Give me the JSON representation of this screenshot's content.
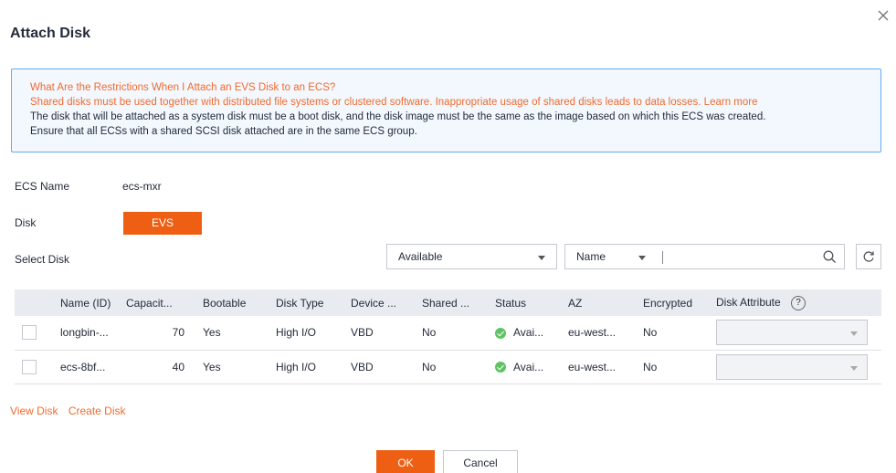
{
  "dialog": {
    "title": "Attach Disk",
    "close_icon": "close-icon"
  },
  "notice": {
    "heading": "What Are the Restrictions When I Attach an EVS Disk to an ECS?",
    "shared_warning": "Shared disks must be used together with distributed file systems or clustered software. Inappropriate usage of shared disks leads to data losses.",
    "learn_more": "Learn more",
    "line3": "The disk that will be attached as a system disk must be a boot disk, and the disk image must be the same as the image based on which this ECS was created.",
    "line4": "Ensure that all ECSs with a shared SCSI disk attached are in the same ECS group."
  },
  "form": {
    "ecs_name_label": "ECS Name",
    "ecs_name_value": "ecs-mxr",
    "disk_label": "Disk",
    "disk_type_button": "EVS",
    "select_disk_label": "Select Disk",
    "status_filter": "Available",
    "search_field": "Name",
    "search_icon": "search-icon",
    "refresh_icon": "refresh-icon"
  },
  "table": {
    "headers": [
      "Name (ID)",
      "Capacit...",
      "Bootable",
      "Disk Type",
      "Device ...",
      "Shared ...",
      "Status",
      "AZ",
      "Encrypted",
      "Disk Attribute"
    ],
    "rows": [
      {
        "name": "longbin-...",
        "capacity": "70",
        "bootable": "Yes",
        "disk_type": "High I/O",
        "device": "VBD",
        "shared": "No",
        "status": "Avai...",
        "az": "eu-west...",
        "encrypted": "No"
      },
      {
        "name": "ecs-8bf...",
        "capacity": "40",
        "bootable": "Yes",
        "disk_type": "High I/O",
        "device": "VBD",
        "shared": "No",
        "status": "Avai...",
        "az": "eu-west...",
        "encrypted": "No"
      }
    ]
  },
  "links": {
    "view_disk": "View Disk",
    "create_disk": "Create Disk"
  },
  "footer": {
    "ok": "OK",
    "cancel": "Cancel"
  },
  "colors": {
    "accent": "#ee5f14",
    "warning_text": "#f26a2e",
    "notice_bg": "#f2f8fe",
    "notice_border": "#64a9f0",
    "status_ok": "#5fc365"
  }
}
